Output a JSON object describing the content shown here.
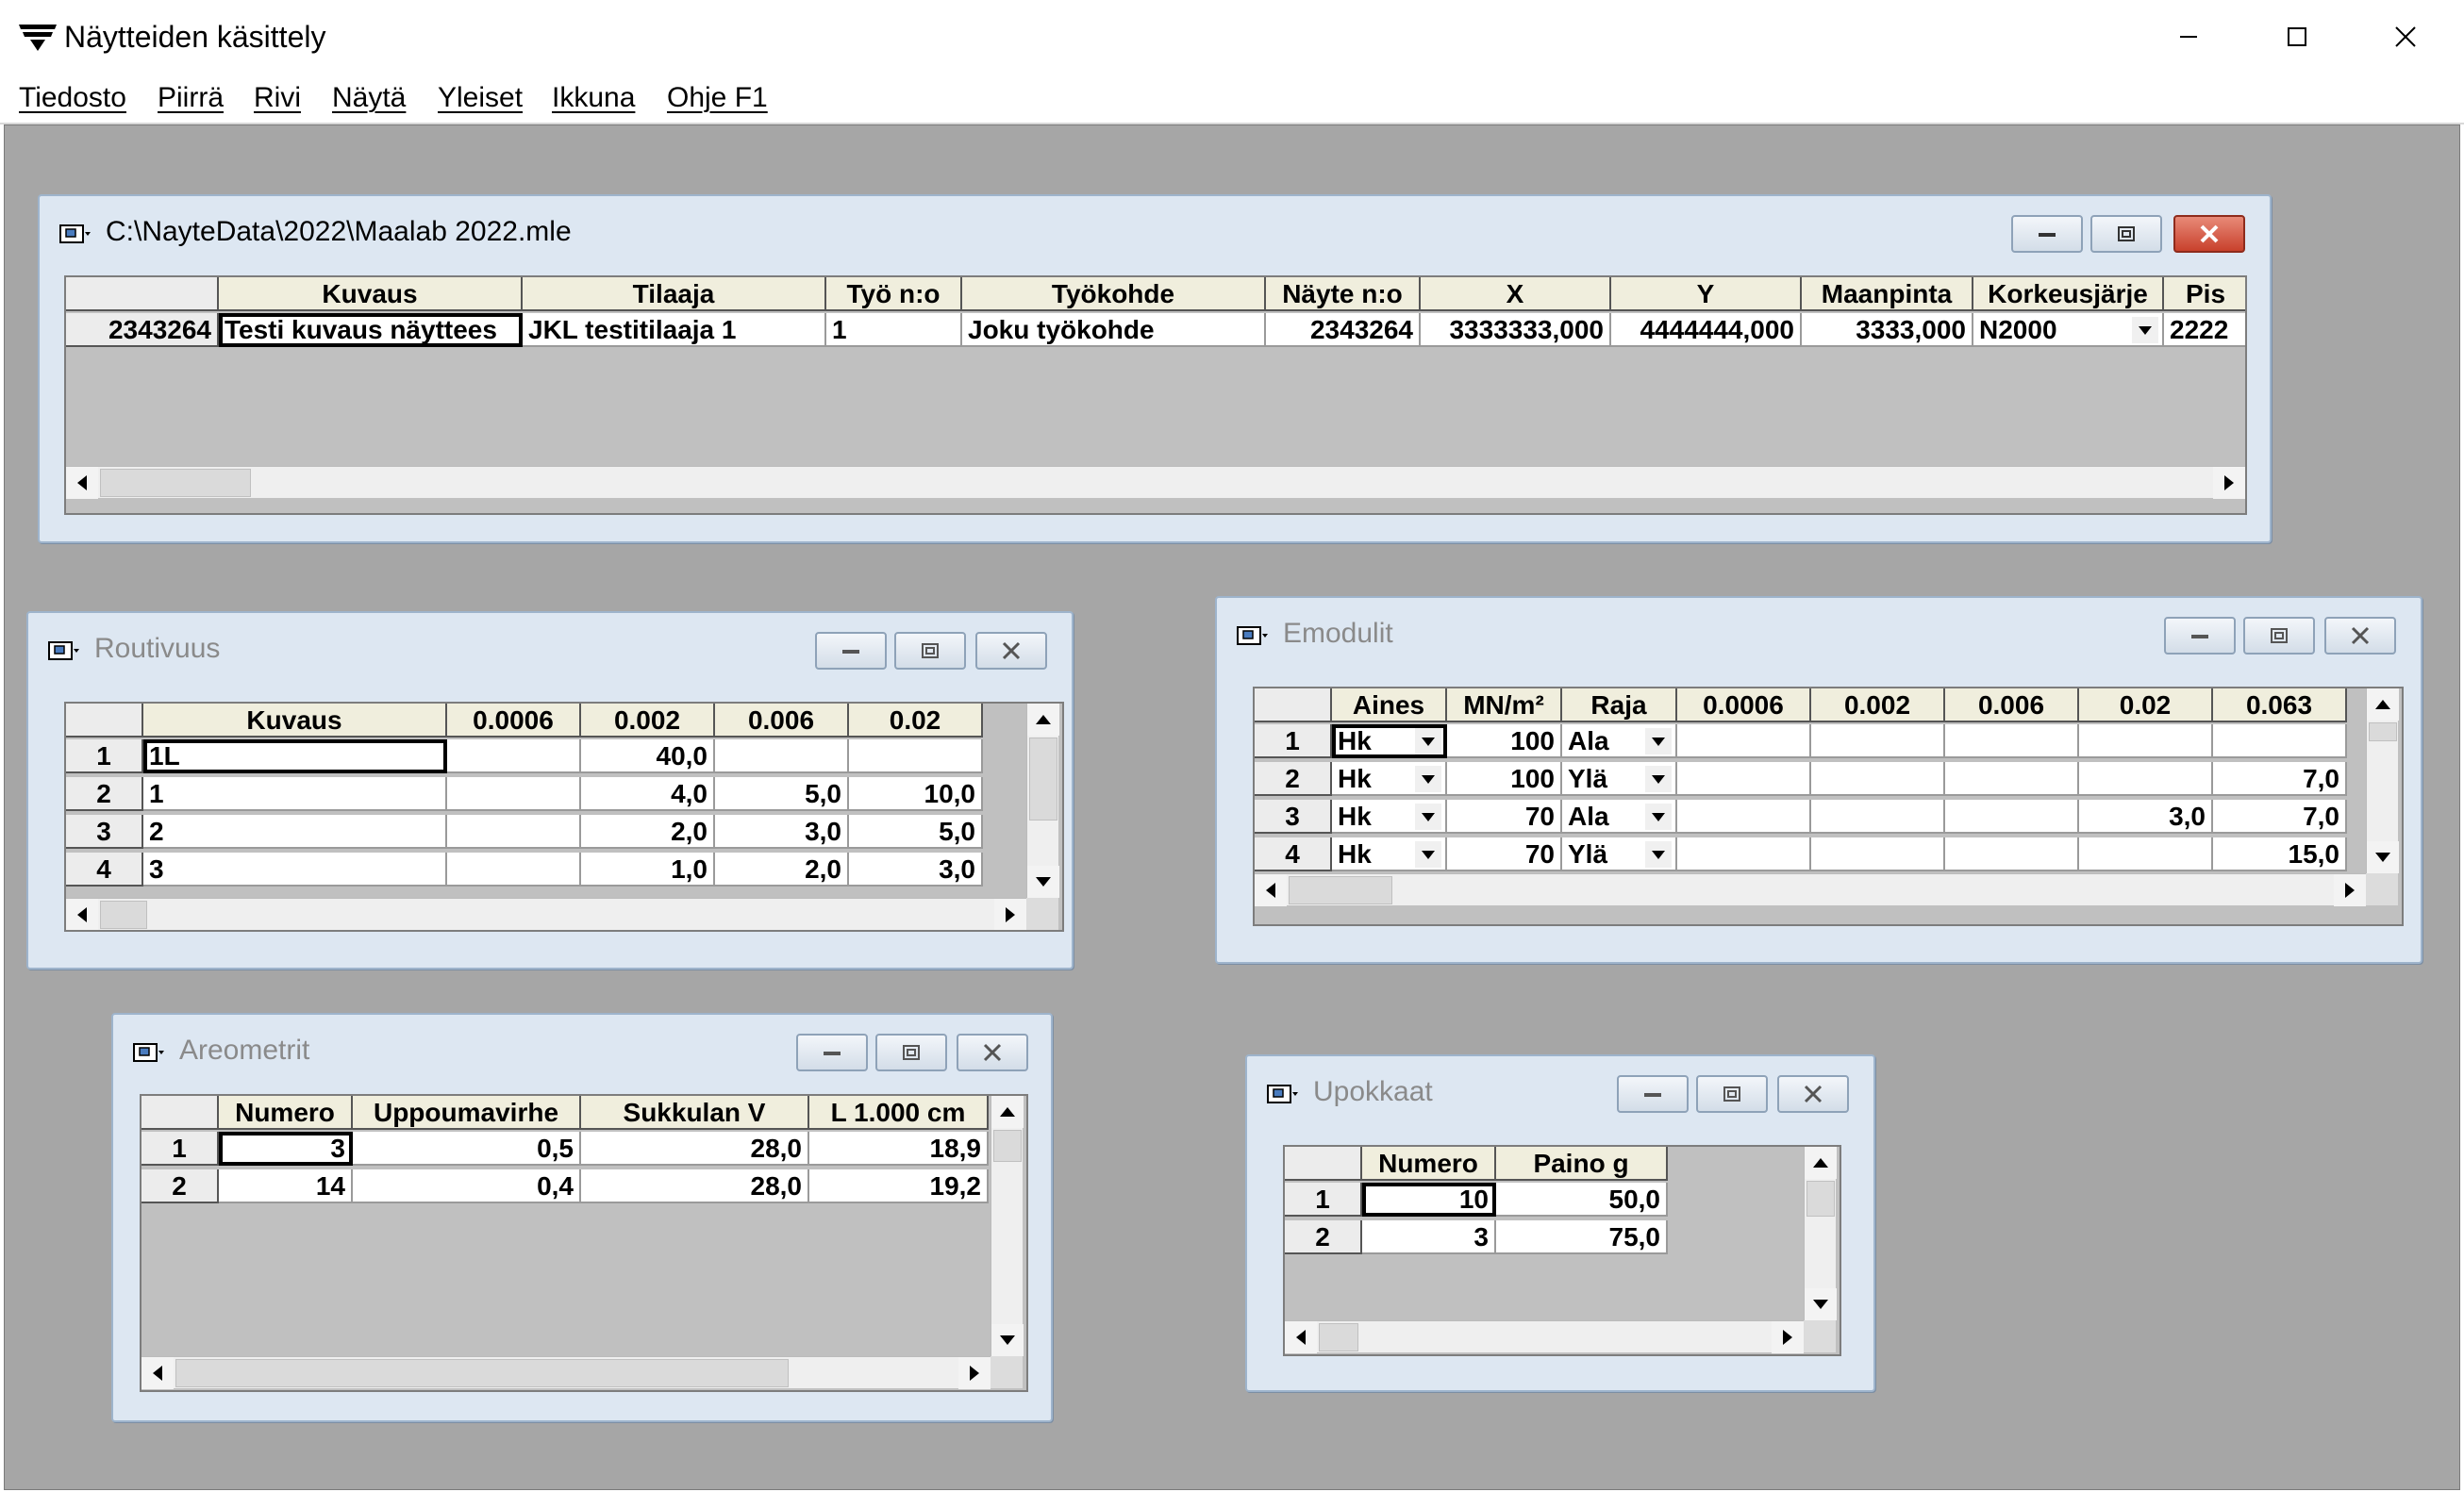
{
  "app": {
    "title": "Näytteiden käsittely",
    "menu": [
      "Tiedosto",
      "Piirrä",
      "Rivi",
      "Näytä",
      "Yleiset",
      "Ikkuna",
      "Ohje F1"
    ]
  },
  "main_window": {
    "title": "C:\\NayteData\\2022\\Maalab 2022.mle",
    "columns": [
      "",
      "Kuvaus",
      "Tilaaja",
      "Työ n:o",
      "Työkohde",
      "Näyte n:o",
      "X",
      "Y",
      "Maanpinta",
      "Korkeusjärje",
      "Pis"
    ],
    "row": [
      "2343264",
      "Testi kuvaus näyttees",
      "JKL testitilaaja 1",
      "1",
      "Joku työkohde",
      "2343264",
      "3333333,000",
      "4444444,000",
      "3333,000",
      "N2000",
      "2222"
    ]
  },
  "routivuus": {
    "title": "Routivuus",
    "columns": [
      "",
      "Kuvaus",
      "0.0006",
      "0.002",
      "0.006",
      "0.02"
    ],
    "rows": [
      [
        "1",
        "1L",
        "",
        "40,0",
        "",
        ""
      ],
      [
        "2",
        "1",
        "",
        "4,0",
        "5,0",
        "10,0"
      ],
      [
        "3",
        "2",
        "",
        "2,0",
        "3,0",
        "5,0"
      ],
      [
        "4",
        "3",
        "",
        "1,0",
        "2,0",
        "3,0"
      ]
    ]
  },
  "emodulit": {
    "title": "Emodulit",
    "columns": [
      "",
      "Aines",
      "MN/m²",
      "Raja",
      "0.0006",
      "0.002",
      "0.006",
      "0.02",
      "0.063"
    ],
    "rows": [
      [
        "1",
        "Hk",
        "100",
        "Ala",
        "",
        "",
        "",
        "",
        ""
      ],
      [
        "2",
        "Hk",
        "100",
        "Ylä",
        "",
        "",
        "",
        "",
        "7,0"
      ],
      [
        "3",
        "Hk",
        "70",
        "Ala",
        "",
        "",
        "",
        "3,0",
        "7,0"
      ],
      [
        "4",
        "Hk",
        "70",
        "Ylä",
        "",
        "",
        "",
        "",
        "15,0"
      ]
    ]
  },
  "areometrit": {
    "title": "Areometrit",
    "columns": [
      "",
      "Numero",
      "Uppoumavirhe",
      "Sukkulan V",
      "L 1.000 cm"
    ],
    "rows": [
      [
        "1",
        "3",
        "0,5",
        "28,0",
        "18,9"
      ],
      [
        "2",
        "14",
        "0,4",
        "28,0",
        "19,2"
      ]
    ]
  },
  "upokkaat": {
    "title": "Upokkaat",
    "columns": [
      "",
      "Numero",
      "Paino g"
    ],
    "rows": [
      [
        "1",
        "10",
        "50,0"
      ],
      [
        "2",
        "3",
        "75,0"
      ]
    ]
  }
}
